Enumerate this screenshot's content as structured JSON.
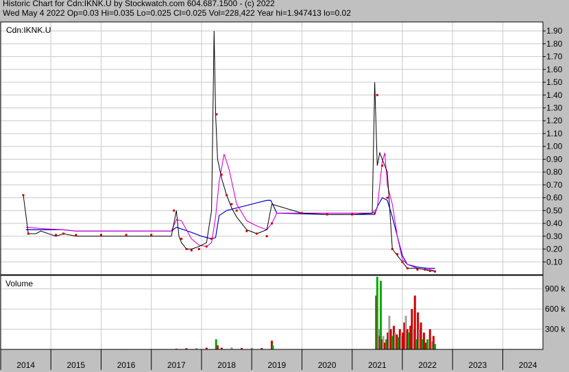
{
  "header": {
    "line1": "Historic Chart for Cdn:IKNK.U by Stockwatch.com 604.687.1500 - (c) 2022",
    "line2": "Wed May  4 2022   Op=0.03   Hi=0.035   Lo=0.025   Cl=0.025   Vol=228,422   Year hi=1.947413   lo=0.02"
  },
  "colors": {
    "background": "#c0c0c0",
    "plot": "#ffffff",
    "grid": "#c8c8c8",
    "price": "#000000",
    "close": "#cc0000",
    "ma_short": "#dd00dd",
    "ma_long": "#0000cc",
    "volume_up": "#00aa00",
    "volume_down": "#cc0000",
    "volume_flat": "#a0a0a0"
  },
  "chart_data": [
    {
      "type": "line",
      "title": "Cdn:IKNK.U",
      "ylim": [
        0,
        1.97
      ],
      "y_ticks": [
        "0.10",
        "0.20",
        "0.30",
        "0.40",
        "0.50",
        "0.60",
        "0.70",
        "0.80",
        "0.90",
        "1.00",
        "1.10",
        "1.20",
        "1.30",
        "1.40",
        "1.50",
        "1.60",
        "1.70",
        "1.80",
        "1.90"
      ],
      "x_ticks": [
        "2014",
        "2015",
        "2016",
        "2017",
        "2018",
        "2019",
        "2020",
        "2021",
        "2022",
        "2023",
        "2024"
      ],
      "grid": true,
      "series": [
        {
          "x": [
            2013.95,
            2014.05,
            2014.2,
            2014.3,
            2014.6,
            2014.75,
            2015.0,
            2015.5,
            2016.0,
            2016.5,
            2016.9,
            2017.0,
            2017.05,
            2017.1,
            2017.2,
            2017.3,
            2017.45,
            2017.6,
            2017.7,
            2017.75,
            2017.78,
            2017.82,
            2017.9,
            2018.0,
            2018.1,
            2018.2,
            2018.4,
            2018.6,
            2018.8,
            2018.9,
            2019.5,
            2020.0,
            2020.5,
            2020.9,
            2020.95,
            2021.0,
            2021.05,
            2021.1,
            2021.2,
            2021.3,
            2021.4,
            2021.5,
            2021.6,
            2021.8,
            2021.95,
            2022.05,
            2022.1,
            2022.15
          ],
          "values": [
            0.62,
            0.32,
            0.32,
            0.34,
            0.3,
            0.32,
            0.3,
            0.3,
            0.3,
            0.3,
            0.3,
            0.5,
            0.3,
            0.25,
            0.2,
            0.2,
            0.22,
            0.25,
            0.5,
            1.9,
            1.25,
            0.9,
            0.75,
            0.62,
            0.52,
            0.45,
            0.35,
            0.32,
            0.35,
            0.55,
            0.48,
            0.47,
            0.47,
            0.48,
            1.5,
            0.85,
            0.95,
            0.9,
            0.8,
            0.2,
            0.15,
            0.1,
            0.05,
            0.05,
            0.04,
            0.03,
            0.03,
            0.025
          ]
        },
        {
          "x": [
            2013.95,
            2014.05,
            2014.6,
            2014.75,
            2015.0,
            2015.5,
            2016.0,
            2016.5,
            2016.95,
            2017.1,
            2017.2,
            2017.3,
            2017.45,
            2017.6,
            2017.7,
            2017.8,
            2017.9,
            2018.0,
            2018.1,
            2018.2,
            2018.4,
            2018.6,
            2018.8,
            2018.9,
            2019.5,
            2020.0,
            2020.5,
            2020.95,
            2021.0,
            2021.1,
            2021.2,
            2021.3,
            2021.4,
            2021.5,
            2021.6,
            2021.8,
            2021.95,
            2022.05,
            2022.15
          ],
          "values": [
            0.62,
            0.32,
            0.31,
            0.32,
            0.31,
            0.31,
            0.31,
            0.31,
            0.5,
            0.28,
            0.2,
            0.19,
            0.2,
            0.22,
            0.28,
            1.25,
            0.78,
            0.62,
            0.55,
            0.5,
            0.34,
            0.32,
            0.3,
            0.4,
            0.48,
            0.47,
            0.47,
            0.48,
            1.4,
            0.85,
            0.6,
            0.2,
            0.16,
            0.1,
            0.05,
            0.04,
            0.04,
            0.03,
            0.025
          ]
        },
        {
          "x": [
            2014.0,
            2014.3,
            2014.75,
            2015.0,
            2016.0,
            2016.9,
            2017.0,
            2017.1,
            2017.2,
            2017.3,
            2017.45,
            2017.6,
            2017.7,
            2017.78,
            2017.85,
            2017.95,
            2018.05,
            2018.2,
            2018.4,
            2018.6,
            2018.8,
            2018.9,
            2019.0,
            2020.0,
            2020.9,
            2021.0,
            2021.1,
            2021.15,
            2021.2,
            2021.3,
            2021.4,
            2021.5,
            2021.6,
            2021.8,
            2021.95,
            2022.05,
            2022.15
          ],
          "values": [
            0.37,
            0.36,
            0.35,
            0.34,
            0.34,
            0.34,
            0.43,
            0.42,
            0.35,
            0.28,
            0.23,
            0.22,
            0.25,
            0.45,
            0.72,
            0.94,
            0.82,
            0.55,
            0.42,
            0.38,
            0.35,
            0.4,
            0.48,
            0.48,
            0.48,
            0.52,
            0.88,
            0.95,
            0.7,
            0.55,
            0.3,
            0.12,
            0.08,
            0.05,
            0.04,
            0.04,
            0.03
          ]
        },
        {
          "x": [
            2014.0,
            2014.3,
            2014.75,
            2015.0,
            2016.0,
            2016.9,
            2017.0,
            2017.3,
            2017.5,
            2017.7,
            2017.78,
            2017.85,
            2018.0,
            2018.2,
            2018.4,
            2018.6,
            2018.8,
            2018.88,
            2019.0,
            2020.0,
            2020.95,
            2021.0,
            2021.1,
            2021.2,
            2021.3,
            2021.4,
            2021.5,
            2021.6,
            2021.8,
            2022.0,
            2022.15
          ],
          "values": [
            0.35,
            0.35,
            0.35,
            0.34,
            0.34,
            0.34,
            0.37,
            0.33,
            0.3,
            0.28,
            0.29,
            0.46,
            0.5,
            0.52,
            0.54,
            0.56,
            0.58,
            0.58,
            0.48,
            0.47,
            0.47,
            0.53,
            0.6,
            0.58,
            0.45,
            0.3,
            0.15,
            0.08,
            0.06,
            0.05,
            0.05
          ]
        }
      ]
    },
    {
      "type": "bar",
      "title": "Volume",
      "ylim": [
        0,
        1100000
      ],
      "y_ticks": [
        "300 k",
        "600 k",
        "900 k"
      ],
      "bars": [
        [
          2014.0,
          5000,
          "f"
        ],
        [
          2014.5,
          4000,
          "f"
        ],
        [
          2015.0,
          5000,
          "f"
        ],
        [
          2016.0,
          3000,
          "f"
        ],
        [
          2017.0,
          15000,
          "f"
        ],
        [
          2017.2,
          18000,
          "d"
        ],
        [
          2017.4,
          20000,
          "f"
        ],
        [
          2017.6,
          25000,
          "d"
        ],
        [
          2017.79,
          150000,
          "u"
        ],
        [
          2017.82,
          60000,
          "d"
        ],
        [
          2017.9,
          25000,
          "d"
        ],
        [
          2018.1,
          30000,
          "f"
        ],
        [
          2018.3,
          20000,
          "d"
        ],
        [
          2018.5,
          25000,
          "f"
        ],
        [
          2018.7,
          20000,
          "d"
        ],
        [
          2018.9,
          130000,
          "d"
        ],
        [
          2018.92,
          60000,
          "u"
        ],
        [
          2020.98,
          800000,
          "d"
        ],
        [
          2021.0,
          1080000,
          "u"
        ],
        [
          2021.03,
          300000,
          "f"
        ],
        [
          2021.05,
          200000,
          "d"
        ],
        [
          2021.07,
          1020000,
          "u"
        ],
        [
          2021.09,
          150000,
          "d"
        ],
        [
          2021.12,
          200000,
          "f"
        ],
        [
          2021.15,
          100000,
          "d"
        ],
        [
          2021.18,
          150000,
          "u"
        ],
        [
          2021.21,
          250000,
          "d"
        ],
        [
          2021.24,
          500000,
          "f"
        ],
        [
          2021.27,
          300000,
          "d"
        ],
        [
          2021.3,
          200000,
          "u"
        ],
        [
          2021.33,
          350000,
          "d"
        ],
        [
          2021.36,
          250000,
          "f"
        ],
        [
          2021.39,
          220000,
          "d"
        ],
        [
          2021.42,
          180000,
          "u"
        ],
        [
          2021.45,
          300000,
          "d"
        ],
        [
          2021.48,
          200000,
          "f"
        ],
        [
          2021.51,
          250000,
          "d"
        ],
        [
          2021.54,
          400000,
          "d"
        ],
        [
          2021.57,
          500000,
          "f"
        ],
        [
          2021.6,
          300000,
          "d"
        ],
        [
          2021.63,
          250000,
          "u"
        ],
        [
          2021.66,
          350000,
          "d"
        ],
        [
          2021.69,
          600000,
          "d"
        ],
        [
          2021.72,
          300000,
          "f"
        ],
        [
          2021.75,
          800000,
          "d"
        ],
        [
          2021.78,
          150000,
          "u"
        ],
        [
          2021.81,
          550000,
          "d"
        ],
        [
          2021.84,
          300000,
          "f"
        ],
        [
          2021.87,
          400000,
          "d"
        ],
        [
          2021.9,
          150000,
          "u"
        ],
        [
          2021.93,
          250000,
          "d"
        ],
        [
          2021.96,
          100000,
          "d"
        ],
        [
          2022.0,
          150000,
          "u"
        ],
        [
          2022.05,
          300000,
          "d"
        ],
        [
          2022.09,
          120000,
          "f"
        ],
        [
          2022.12,
          200000,
          "d"
        ],
        [
          2022.15,
          80000,
          "u"
        ]
      ]
    }
  ]
}
